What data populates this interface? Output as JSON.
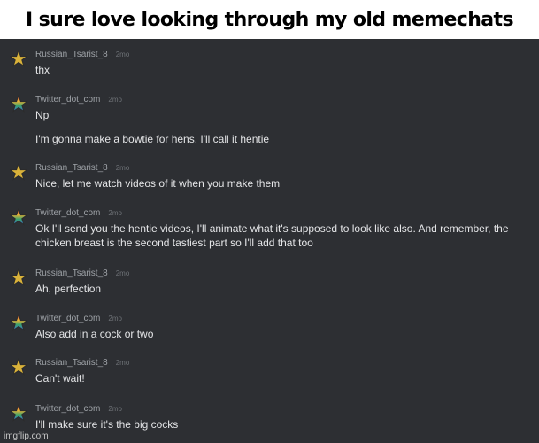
{
  "caption": "I sure love looking through my old memechats",
  "watermark": "imgflip.com",
  "messages": [
    {
      "user": "Russian_Tsarist_8",
      "time": "2mo",
      "avatar": "gold-star-icon",
      "lines": [
        "thx"
      ]
    },
    {
      "user": "Twitter_dot_com",
      "time": "2mo",
      "avatar": "rainbow-star-icon",
      "lines": [
        "Np",
        "I'm gonna make a bowtie for hens, I'll call it hentie"
      ]
    },
    {
      "user": "Russian_Tsarist_8",
      "time": "2mo",
      "avatar": "gold-star-icon",
      "lines": [
        "Nice, let me watch videos of it when you make them"
      ]
    },
    {
      "user": "Twitter_dot_com",
      "time": "2mo",
      "avatar": "rainbow-star-icon",
      "lines": [
        "Ok I'll send you the hentie videos, I'll animate what it's supposed to look like also. And remember, the chicken breast is the second tastiest part so I'll add that too"
      ]
    },
    {
      "user": "Russian_Tsarist_8",
      "time": "2mo",
      "avatar": "gold-star-icon",
      "lines": [
        "Ah, perfection"
      ]
    },
    {
      "user": "Twitter_dot_com",
      "time": "2mo",
      "avatar": "rainbow-star-icon",
      "lines": [
        "Also add in a cock or two"
      ]
    },
    {
      "user": "Russian_Tsarist_8",
      "time": "2mo",
      "avatar": "gold-star-icon",
      "lines": [
        "Can't wait!"
      ]
    },
    {
      "user": "Twitter_dot_com",
      "time": "2mo",
      "avatar": "rainbow-star-icon",
      "lines": [
        "I'll make sure it's the big cocks"
      ]
    }
  ]
}
